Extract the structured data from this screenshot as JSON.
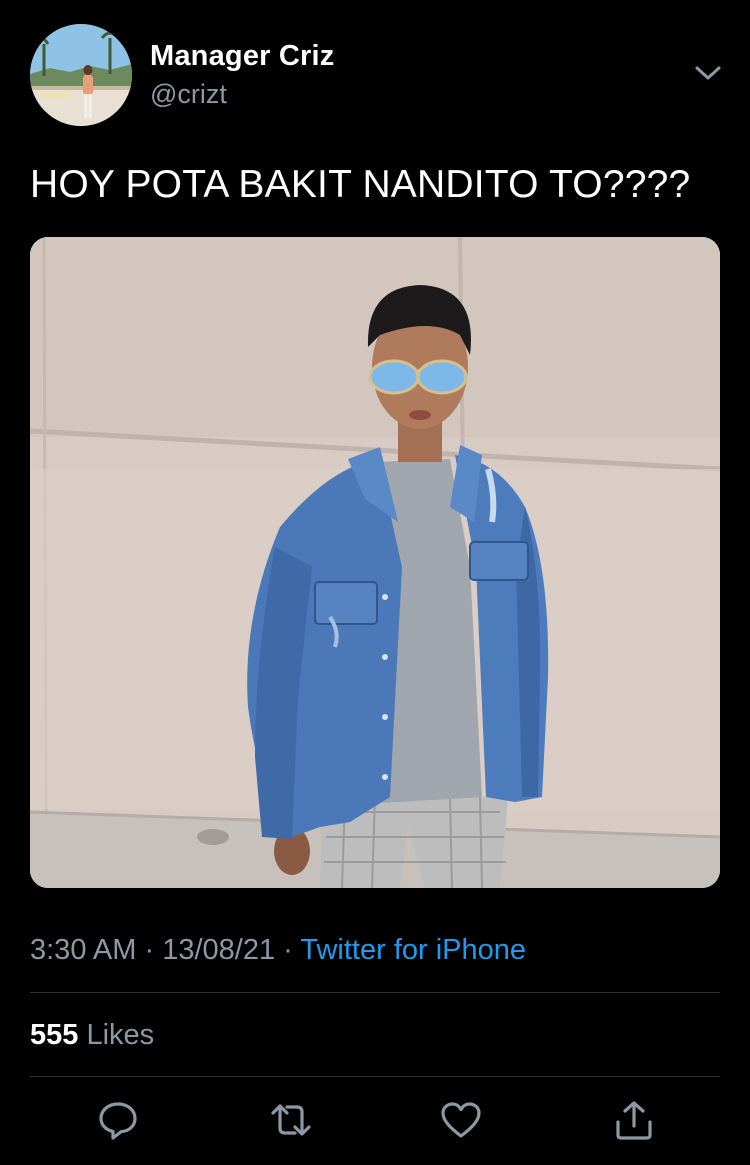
{
  "user": {
    "display_name": "Manager Criz",
    "handle": "@crizt"
  },
  "tweet": {
    "text": "HOY POTA BAKIT NANDITO TO????"
  },
  "meta": {
    "time": "3:30 AM",
    "separator": "·",
    "date": "13/08/21",
    "source": "Twitter for iPhone"
  },
  "stats": {
    "likes_count": "555",
    "likes_label": "Likes"
  },
  "icons": {
    "more": "chevron-down-icon",
    "reply": "reply-bubble-icon",
    "retweet": "retweet-icon",
    "like": "heart-icon",
    "share": "share-icon"
  },
  "colors": {
    "background": "#000000",
    "text_primary": "#ffffff",
    "text_secondary": "#8b98a5",
    "link": "#1d9bf0",
    "divider": "#2f3336"
  }
}
